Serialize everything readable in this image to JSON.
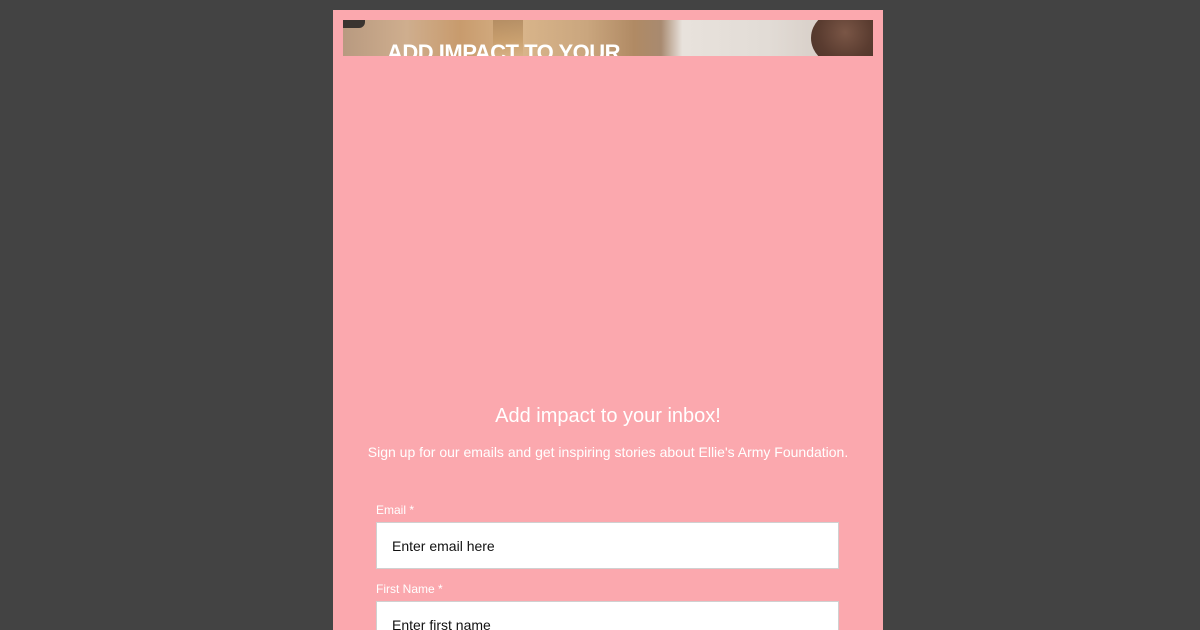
{
  "banner": {
    "text": "ADD IMPACT TO YOUR"
  },
  "signup": {
    "headline": "Add impact to your inbox!",
    "subtext": "Sign up for our emails and get inspiring stories about Ellie's Army Foundation."
  },
  "form": {
    "email": {
      "label": "Email *",
      "placeholder": "Enter email here",
      "value": ""
    },
    "first_name": {
      "label": "First Name *",
      "placeholder": "Enter first name",
      "value": ""
    }
  },
  "colors": {
    "page_background": "#434343",
    "card_background": "#fba8ae",
    "text": "#ffffff",
    "input_background": "#ffffff"
  }
}
